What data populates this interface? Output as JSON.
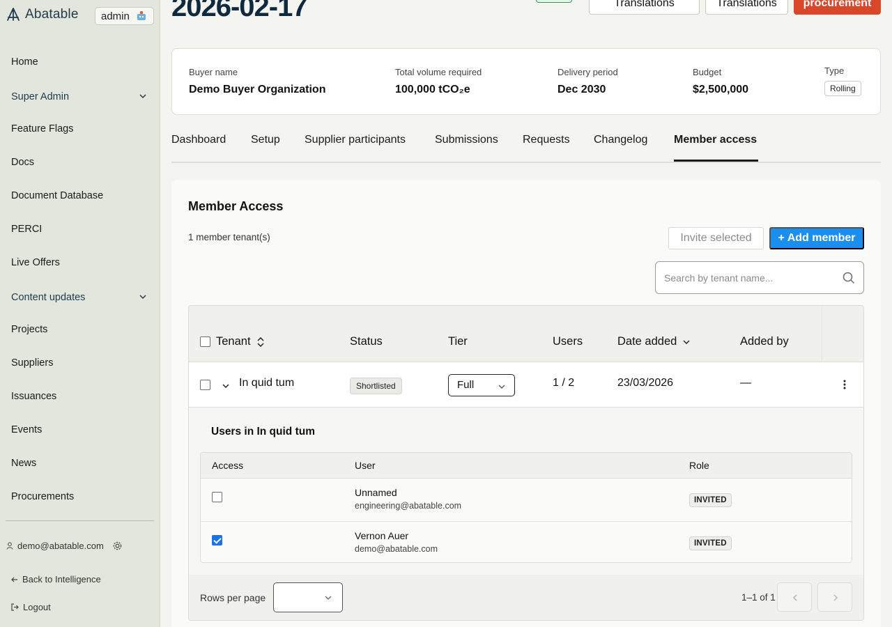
{
  "brand": {
    "name": "Abatable",
    "role_pill": "admin"
  },
  "sidebar": {
    "items": [
      {
        "label": "Home"
      },
      {
        "label": "Super Admin"
      },
      {
        "label": "Feature Flags"
      },
      {
        "label": "Docs"
      },
      {
        "label": "Document Database"
      },
      {
        "label": "PERCI"
      },
      {
        "label": "Live Offers"
      },
      {
        "label": "Content updates"
      },
      {
        "label": "Projects"
      },
      {
        "label": "Suppliers"
      },
      {
        "label": "Issuances"
      },
      {
        "label": "Events"
      },
      {
        "label": "News"
      },
      {
        "label": "Procurements"
      }
    ],
    "user_email": "demo@abatable.com",
    "back_link": "Back to Intelligence",
    "logout": "Logout"
  },
  "header": {
    "title": "2026-02-17",
    "buttons": [
      "Translations",
      "Translations",
      "procurement"
    ]
  },
  "summary": {
    "buyer_label": "Buyer name",
    "buyer_value": "Demo Buyer Organization",
    "volume_label": "Total volume required",
    "volume_value": "100,000 tCO₂e",
    "delivery_label": "Delivery period",
    "delivery_value": "Dec 2030",
    "budget_label": "Budget",
    "budget_value": "$2,500,000",
    "type_label": "Type",
    "type_value": "Rolling"
  },
  "tabs": [
    "Dashboard",
    "Setup",
    "Supplier participants",
    "Submissions",
    "Requests",
    "Changelog",
    "Member access"
  ],
  "active_tab": "Member access",
  "member_access": {
    "title": "Member Access",
    "count_text": "1 member tenant(s)",
    "invite_label": "Invite selected",
    "add_label": "+ Add member",
    "search_placeholder": "Search by tenant name...",
    "columns": [
      "Tenant",
      "Status",
      "Tier",
      "Users",
      "Date added",
      "Added by"
    ],
    "rows": [
      {
        "tenant": "In quid tum",
        "status": "Shortlisted",
        "tier": "Full",
        "users": "1 / 2",
        "date_added": "23/03/2026",
        "added_by": "—"
      }
    ],
    "expanded": {
      "title": "Users in In quid tum",
      "columns": [
        "Access",
        "User",
        "Role"
      ],
      "users": [
        {
          "name": "Unnamed",
          "email": "engineering@abatable.com",
          "role": "INVITED",
          "access": false
        },
        {
          "name": "Vernon Auer",
          "email": "demo@abatable.com",
          "role": "INVITED",
          "access": true
        }
      ]
    },
    "pagination": {
      "rows_per_page_label": "Rows per page",
      "rows_per_page_value": "",
      "range": "1–1 of 1"
    }
  },
  "colors": {
    "accent_blue": "#1a8ff0",
    "primary_red": "#d9472b",
    "title_navy": "#0f2a3f",
    "sidebar_bg": "#e3e6dc"
  }
}
